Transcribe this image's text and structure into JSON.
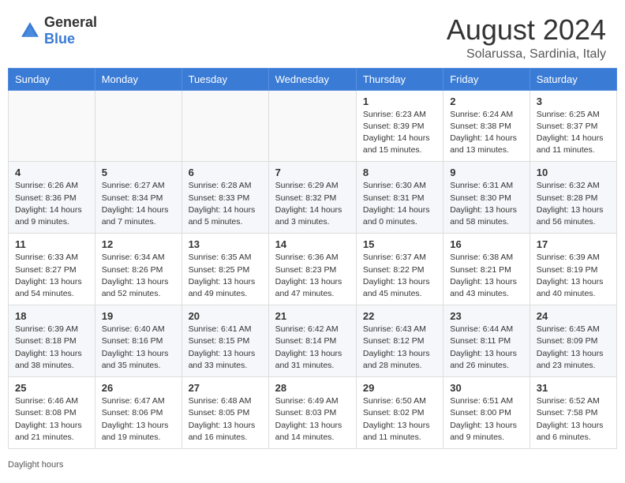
{
  "header": {
    "logo_general": "General",
    "logo_blue": "Blue",
    "month_year": "August 2024",
    "location": "Solarussa, Sardinia, Italy"
  },
  "weekdays": [
    "Sunday",
    "Monday",
    "Tuesday",
    "Wednesday",
    "Thursday",
    "Friday",
    "Saturday"
  ],
  "footer": {
    "note": "Daylight hours"
  },
  "weeks": [
    [
      {
        "day": "",
        "info": ""
      },
      {
        "day": "",
        "info": ""
      },
      {
        "day": "",
        "info": ""
      },
      {
        "day": "",
        "info": ""
      },
      {
        "day": "1",
        "info": "Sunrise: 6:23 AM\nSunset: 8:39 PM\nDaylight: 14 hours\nand 15 minutes."
      },
      {
        "day": "2",
        "info": "Sunrise: 6:24 AM\nSunset: 8:38 PM\nDaylight: 14 hours\nand 13 minutes."
      },
      {
        "day": "3",
        "info": "Sunrise: 6:25 AM\nSunset: 8:37 PM\nDaylight: 14 hours\nand 11 minutes."
      }
    ],
    [
      {
        "day": "4",
        "info": "Sunrise: 6:26 AM\nSunset: 8:36 PM\nDaylight: 14 hours\nand 9 minutes."
      },
      {
        "day": "5",
        "info": "Sunrise: 6:27 AM\nSunset: 8:34 PM\nDaylight: 14 hours\nand 7 minutes."
      },
      {
        "day": "6",
        "info": "Sunrise: 6:28 AM\nSunset: 8:33 PM\nDaylight: 14 hours\nand 5 minutes."
      },
      {
        "day": "7",
        "info": "Sunrise: 6:29 AM\nSunset: 8:32 PM\nDaylight: 14 hours\nand 3 minutes."
      },
      {
        "day": "8",
        "info": "Sunrise: 6:30 AM\nSunset: 8:31 PM\nDaylight: 14 hours\nand 0 minutes."
      },
      {
        "day": "9",
        "info": "Sunrise: 6:31 AM\nSunset: 8:30 PM\nDaylight: 13 hours\nand 58 minutes."
      },
      {
        "day": "10",
        "info": "Sunrise: 6:32 AM\nSunset: 8:28 PM\nDaylight: 13 hours\nand 56 minutes."
      }
    ],
    [
      {
        "day": "11",
        "info": "Sunrise: 6:33 AM\nSunset: 8:27 PM\nDaylight: 13 hours\nand 54 minutes."
      },
      {
        "day": "12",
        "info": "Sunrise: 6:34 AM\nSunset: 8:26 PM\nDaylight: 13 hours\nand 52 minutes."
      },
      {
        "day": "13",
        "info": "Sunrise: 6:35 AM\nSunset: 8:25 PM\nDaylight: 13 hours\nand 49 minutes."
      },
      {
        "day": "14",
        "info": "Sunrise: 6:36 AM\nSunset: 8:23 PM\nDaylight: 13 hours\nand 47 minutes."
      },
      {
        "day": "15",
        "info": "Sunrise: 6:37 AM\nSunset: 8:22 PM\nDaylight: 13 hours\nand 45 minutes."
      },
      {
        "day": "16",
        "info": "Sunrise: 6:38 AM\nSunset: 8:21 PM\nDaylight: 13 hours\nand 43 minutes."
      },
      {
        "day": "17",
        "info": "Sunrise: 6:39 AM\nSunset: 8:19 PM\nDaylight: 13 hours\nand 40 minutes."
      }
    ],
    [
      {
        "day": "18",
        "info": "Sunrise: 6:39 AM\nSunset: 8:18 PM\nDaylight: 13 hours\nand 38 minutes."
      },
      {
        "day": "19",
        "info": "Sunrise: 6:40 AM\nSunset: 8:16 PM\nDaylight: 13 hours\nand 35 minutes."
      },
      {
        "day": "20",
        "info": "Sunrise: 6:41 AM\nSunset: 8:15 PM\nDaylight: 13 hours\nand 33 minutes."
      },
      {
        "day": "21",
        "info": "Sunrise: 6:42 AM\nSunset: 8:14 PM\nDaylight: 13 hours\nand 31 minutes."
      },
      {
        "day": "22",
        "info": "Sunrise: 6:43 AM\nSunset: 8:12 PM\nDaylight: 13 hours\nand 28 minutes."
      },
      {
        "day": "23",
        "info": "Sunrise: 6:44 AM\nSunset: 8:11 PM\nDaylight: 13 hours\nand 26 minutes."
      },
      {
        "day": "24",
        "info": "Sunrise: 6:45 AM\nSunset: 8:09 PM\nDaylight: 13 hours\nand 23 minutes."
      }
    ],
    [
      {
        "day": "25",
        "info": "Sunrise: 6:46 AM\nSunset: 8:08 PM\nDaylight: 13 hours\nand 21 minutes."
      },
      {
        "day": "26",
        "info": "Sunrise: 6:47 AM\nSunset: 8:06 PM\nDaylight: 13 hours\nand 19 minutes."
      },
      {
        "day": "27",
        "info": "Sunrise: 6:48 AM\nSunset: 8:05 PM\nDaylight: 13 hours\nand 16 minutes."
      },
      {
        "day": "28",
        "info": "Sunrise: 6:49 AM\nSunset: 8:03 PM\nDaylight: 13 hours\nand 14 minutes."
      },
      {
        "day": "29",
        "info": "Sunrise: 6:50 AM\nSunset: 8:02 PM\nDaylight: 13 hours\nand 11 minutes."
      },
      {
        "day": "30",
        "info": "Sunrise: 6:51 AM\nSunset: 8:00 PM\nDaylight: 13 hours\nand 9 minutes."
      },
      {
        "day": "31",
        "info": "Sunrise: 6:52 AM\nSunset: 7:58 PM\nDaylight: 13 hours\nand 6 minutes."
      }
    ]
  ]
}
